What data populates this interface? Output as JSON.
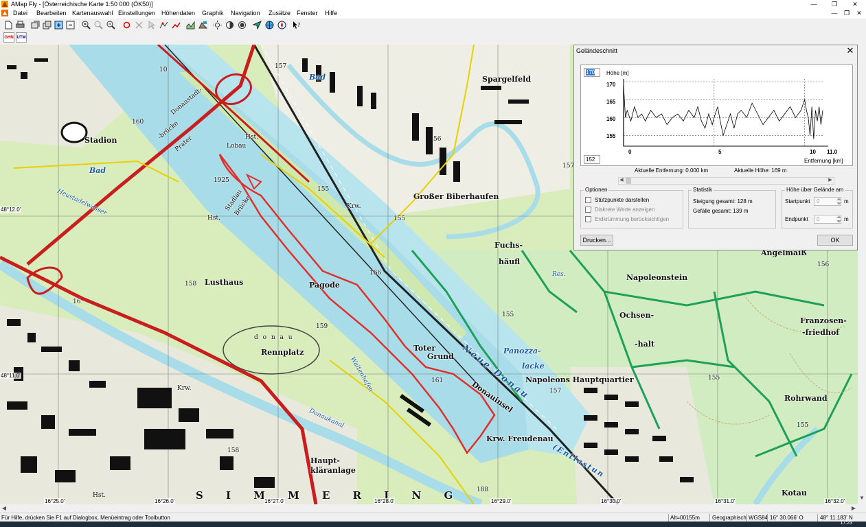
{
  "window": {
    "title": "AMap Fly - [Österreichische Karte 1:50 000 (ÖK50)]",
    "controls": [
      "—",
      "❐",
      "✕"
    ]
  },
  "menu": {
    "items": [
      "Datei",
      "Bearbeiten",
      "Kartenauswahl",
      "Einstellungen",
      "Höhendaten",
      "Graphik",
      "Navigation",
      "Zusätze",
      "Fenster",
      "Hilfe"
    ],
    "mdi_controls": [
      "—",
      "❐",
      "✕"
    ]
  },
  "toolbar2": {
    "btn1": "GHN",
    "btn2": "UTM"
  },
  "map": {
    "labels": {
      "stadion": "Stadion",
      "bad1": "Bad",
      "bad2": "Bad",
      "donaustadt": "Donaustadt-",
      "bruecke": "-brücke",
      "prater": "Prater",
      "lobau": "Lobau",
      "hst1": "Hst.",
      "hst2": "Hst.",
      "hst3": "Hst.",
      "y1925": "1925",
      "stadlau": "Stadlau",
      "bruecke2": "Brücke",
      "spargelfeld": "Spargelfeld",
      "biberhaufen": "Großer Biberhaufen",
      "krw1": "Krw.",
      "krw2": "Krw.",
      "fuchs": "Fuchs-",
      "haeufl": "häufl",
      "heustadlwasser": "Heustadelwasser",
      "lusthaus": "Lusthaus",
      "pagode": "Pagode",
      "rennplatz": "Rennplatz",
      "donau": "d o n a u",
      "toter": "Toter",
      "grund": "Grund",
      "neuedonau": "Neue Donau",
      "panozza": "Panozza-",
      "lacke": "lacke",
      "napoleonstein": "Napoleonstein",
      "ochsen": "Ochsen-",
      "halt": "-halt",
      "napoleons": "Napoleons Hauptquartier",
      "angelmaiss": "Angelmaiß",
      "franzosen": "Franzosen-",
      "friedhof": "-friedhof",
      "rohrwand": "Rohrwand",
      "kotau": "Kotau",
      "donauinsel": "Donauinsel",
      "freudenau": "Krw. Freudenau",
      "entlastung": "(Entlastun",
      "waltenhofen": "Waltenhafen",
      "donaukanal": "Donaukanal",
      "haupt": "Haupt-",
      "klaranlage": "kläranlage",
      "simmering": "S I M M E R I N G",
      "res": "Res.",
      "e160": "160",
      "e157a": "157",
      "e157b": "157",
      "e155a": "155",
      "e155b": "155",
      "e155c": "155",
      "e155d": "155",
      "e158a": "158",
      "e158b": "158",
      "e159": "159",
      "e166": "166",
      "e156": "156",
      "e161": "161",
      "e16": "16",
      "e56": "56",
      "e188": "188",
      "e159b": "159",
      "e157c": "157",
      "e155e": "155",
      "e155f": "155",
      "e156b": "156",
      "e10": "10"
    },
    "coords": {
      "lat1": "48°12.0'",
      "lat2": "48°11.0'",
      "lon1": "16°25.0'",
      "lon2": "16°26.0'",
      "lon3": "16°27.0'",
      "lon4": "16°28.0'",
      "lon5": "16°29.0'",
      "lon6": "16°30.0'",
      "lon7": "16°31.0'",
      "lon8": "16°32.0'"
    },
    "colors": {
      "land": "#d8ecbc",
      "water": "#a8dce8",
      "track": "#e0302a",
      "road": "#c81e1e",
      "trail": "#1ea05a"
    }
  },
  "dialog": {
    "title": "Geländeschnitt",
    "close": "✕",
    "profile": {
      "spin_top": "170",
      "spin_bottom": "152",
      "y_title": "Höhe [m]",
      "y_ticks": [
        "170",
        "165",
        "160",
        "155"
      ],
      "x_ticks": [
        "0",
        "5",
        "10",
        "11.0"
      ],
      "x_title": "Entfernung [km]",
      "current_distance": "Aktuelle Entfernung: 0.000 km",
      "current_height": "Aktuelle Höhe: 169 m"
    },
    "options": {
      "title": "Optionen",
      "items": [
        "Stützpunkte darstellen",
        "Diskrete Werte anzeigen",
        "Erdkrümmung berücksichtigen"
      ]
    },
    "statistik": {
      "title": "Statistik",
      "ascent": "Steigung gesamt: 128 m",
      "descent": "Gefälle gesamt: 139 m"
    },
    "hoehe": {
      "title": "Höhe über Gelände am",
      "start_label": "Startpunkt",
      "end_label": "Endpunkt",
      "start_value": "0",
      "end_value": "0",
      "unit": "m"
    },
    "print_button": "Drucken...",
    "ok_button": "OK"
  },
  "chart_data": {
    "type": "line",
    "title": "Höhe [m]",
    "xlabel": "Entfernung [km]",
    "ylabel": "Höhe [m]",
    "xlim": [
      0,
      11.0
    ],
    "ylim": [
      152,
      170
    ],
    "grid": true,
    "series": [
      {
        "x": [
          0,
          0.1,
          0.2,
          0.4,
          0.6,
          0.8,
          1.0,
          1.2,
          1.5,
          1.8,
          2.1,
          2.4,
          2.7,
          3.0,
          3.3,
          3.6,
          3.9,
          4.1,
          4.3,
          4.5,
          4.7,
          4.9,
          5.0,
          5.2,
          5.3,
          5.5,
          5.7,
          5.9,
          6.1,
          6.3,
          6.5,
          6.8,
          7.1,
          7.4,
          7.7,
          8.0,
          8.3,
          8.6,
          8.9,
          9.2,
          9.5,
          9.8,
          10.0,
          10.1,
          10.2,
          10.3,
          10.4,
          10.5,
          10.6,
          10.7,
          10.8,
          10.9,
          11.0
        ],
        "y": [
          169,
          160,
          162,
          159,
          163,
          160,
          161,
          159,
          162,
          160,
          161,
          158,
          160,
          161,
          159,
          162,
          160,
          163,
          159,
          157,
          161,
          158,
          160,
          163,
          160,
          155,
          158,
          161,
          157,
          161,
          162,
          160,
          164,
          161,
          158,
          160,
          162,
          159,
          161,
          163,
          160,
          162,
          165,
          162,
          160,
          155,
          163,
          154,
          162,
          159,
          163,
          158,
          162
        ]
      }
    ]
  },
  "statusbar": {
    "help": "Für Hilfe, drücken Sie F1 auf Dialogbox, Menüeintrag oder Toolbutton",
    "alt": "Alt=00155m",
    "geo": "Geographisch",
    "datum": "WGS84",
    "lon": "16° 30.066' O",
    "lat": "48° 11.183' N"
  },
  "taskbar": {
    "time": "17:23"
  }
}
